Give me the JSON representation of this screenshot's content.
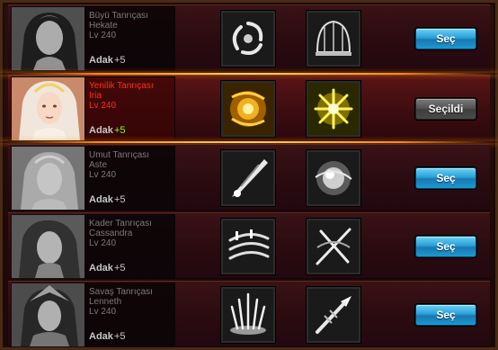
{
  "adak_label": "Adak",
  "goddesses": [
    {
      "title": "Büyü Tanrıçası",
      "name": "Hekate",
      "level": "Lv 240",
      "adak_value": "+5",
      "button": "Seç",
      "selected": false,
      "skills": [
        "vortex-skill-icon",
        "dome-cage-skill-icon"
      ]
    },
    {
      "title": "Yenilik Tanrıçası",
      "name": "Iria",
      "level": "Lv 240",
      "adak_value": "+5",
      "button": "Seçildi",
      "selected": true,
      "skills": [
        "golden-swirl-skill-icon",
        "starburst-skill-icon"
      ]
    },
    {
      "title": "Umut Tanrıçası",
      "name": "Aste",
      "level": "Lv 240",
      "adak_value": "+5",
      "button": "Seç",
      "selected": false,
      "skills": [
        "crystal-beam-skill-icon",
        "orb-skill-icon"
      ]
    },
    {
      "title": "Kader Tanrıçası",
      "name": "Cassandra",
      "level": "Lv 240",
      "adak_value": "+5",
      "button": "Seç",
      "selected": false,
      "skills": [
        "wind-slash-skill-icon",
        "cross-slash-skill-icon"
      ]
    },
    {
      "title": "Savaş Tanrıçası",
      "name": "Lenneth",
      "level": "Lv 240",
      "adak_value": "+5",
      "button": "Seç",
      "selected": false,
      "skills": [
        "light-pillar-skill-icon",
        "spear-skill-icon"
      ]
    }
  ],
  "colors": {
    "selected_text": "#ff3018",
    "adak_bonus_selected": "#7cff2a",
    "button_blue": "#2aa0d8"
  }
}
